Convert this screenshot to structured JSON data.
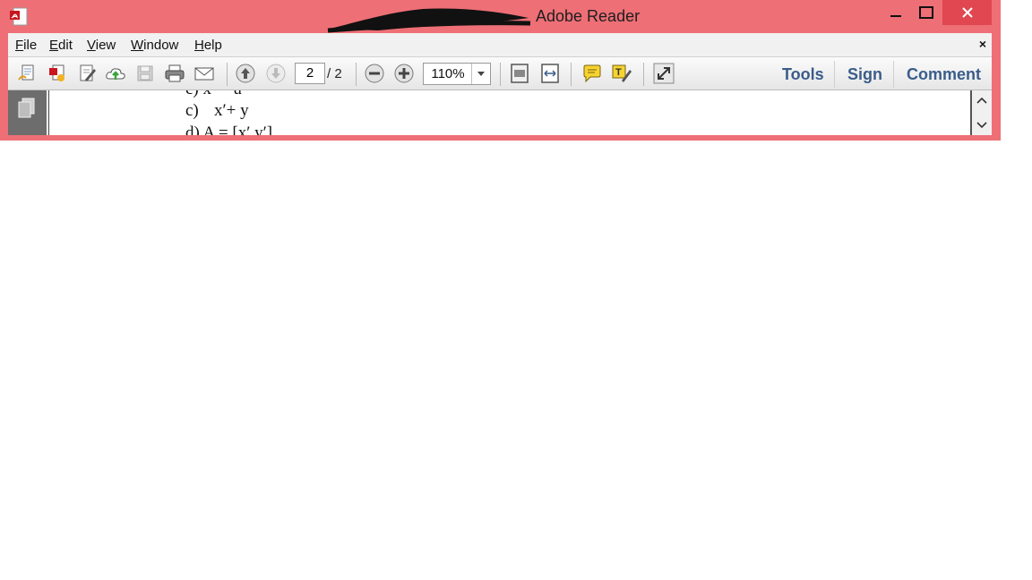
{
  "window": {
    "title": "Adobe Reader"
  },
  "menu": {
    "items": [
      {
        "label": "File",
        "key": "F",
        "rest": "ile"
      },
      {
        "label": "Edit",
        "key": "E",
        "rest": "dit"
      },
      {
        "label": "View",
        "key": "V",
        "rest": "iew"
      },
      {
        "label": "Window",
        "key": "W",
        "rest": "indow"
      },
      {
        "label": "Help",
        "key": "H",
        "rest": "elp"
      }
    ],
    "close": "×"
  },
  "toolbar": {
    "page_current": "2",
    "page_of": "/  2",
    "zoom": "110%",
    "tools_label": "Tools",
    "sign_label": "Sign",
    "comment_label": "Comment"
  },
  "document": {
    "line_top": "c)   x′ = u",
    "line_c_label": "c)",
    "line_c_expr": "x′+ y",
    "line_d": "d)   A = [x′ y′]"
  },
  "colors": {
    "frame": "#ee6f76",
    "close": "#e04750",
    "accent": "#3a5d8a"
  }
}
